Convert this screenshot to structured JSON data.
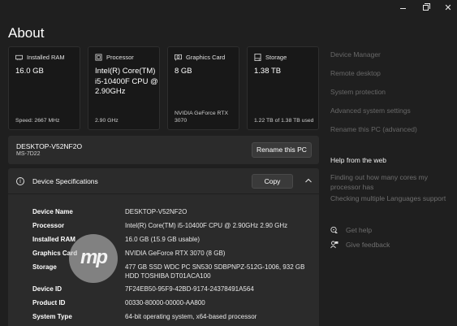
{
  "window": {
    "minimize_glyph": "",
    "close_glyph": "✕"
  },
  "page": {
    "title": "About"
  },
  "cards": [
    {
      "icon": "ram-icon",
      "label": "Installed RAM",
      "value": "16.0 GB",
      "foot": "Speed: 2667 MHz"
    },
    {
      "icon": "processor-icon",
      "label": "Processor",
      "value": "Intel(R) Core(TM) i5-10400F CPU @ 2.90GHz",
      "foot": "2.90 GHz"
    },
    {
      "icon": "graphics-card-icon",
      "label": "Graphics Card",
      "value": "8 GB",
      "foot": "NVIDIA GeForce RTX 3070"
    },
    {
      "icon": "storage-icon",
      "label": "Storage",
      "value": "1.38 TB",
      "foot": "1.22 TB of 1.38 TB used"
    }
  ],
  "device": {
    "name": "DESKTOP-V52NF2O",
    "model": "MS-7D22",
    "rename_label": "Rename this PC"
  },
  "specs": {
    "title": "Device Specifications",
    "copy_label": "Copy",
    "rows": [
      {
        "label": "Device Name",
        "value": "DESKTOP-V52NF2O"
      },
      {
        "label": "Processor",
        "value": "Intel(R) Core(TM) i5-10400F CPU @ 2.90GHz   2.90 GHz"
      },
      {
        "label": "Installed RAM",
        "value": "16.0 GB (15.9 GB usable)"
      },
      {
        "label": "Graphics Card",
        "value": "NVIDIA GeForce RTX 3070 (8 GB)"
      },
      {
        "label": "Storage",
        "value": "477 GB SSD WDC PC SN530 SDBPNPZ-512G-1006, 932 GB HDD TOSHIBA DT01ACA100"
      },
      {
        "label": "Device ID",
        "value": "7F24EB50-95F9-42BD-9174-24378491A564"
      },
      {
        "label": "Product ID",
        "value": "00330-80000-00000-AA800"
      },
      {
        "label": "System Type",
        "value": "64-bit operating system, x64-based processor"
      }
    ]
  },
  "watermark": {
    "text": "mp"
  },
  "related": {
    "links": [
      "Device Manager",
      "Remote desktop",
      "System protection",
      "Advanced system settings",
      "Rename this PC (advanced)"
    ],
    "web_heading": "Help from the web",
    "web_links": [
      "Finding out how many cores my processor has",
      "Checking multiple Languages support"
    ],
    "help": [
      {
        "icon": "get-help-icon",
        "label": "Get help"
      },
      {
        "icon": "give-feedback-icon",
        "label": "Give feedback"
      }
    ]
  }
}
